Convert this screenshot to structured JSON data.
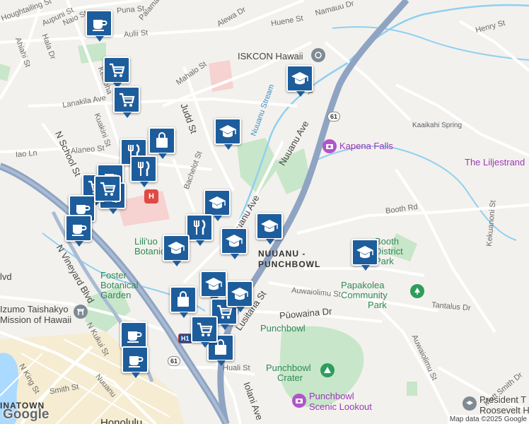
{
  "roads": [
    "Houghtailing St",
    "Aupuni St",
    "Naio St",
    "Puna St",
    "Palama St",
    "Aulii St",
    "Alewa Dr",
    "Huene St",
    "Namauu Dr",
    "Henry St",
    "Ahiahi St",
    "Hala Dr",
    "Mahalo St",
    "Kealoha",
    "Lanakila Ave",
    "Kuakini St",
    "Judd St",
    "Alaneo St",
    "Iao Ln",
    "N School St",
    "Bachelot St",
    "Nuuanu Ave",
    "Booth Rd",
    "Kekuanoni St",
    "N Vineyard Blvd",
    "Auwaiolimu St",
    "Tantalus Dr",
    "Lusitana St",
    "Pūowaina Dr",
    "N Kukui St",
    "Nuuanu",
    "N King St",
    "Smith St",
    "Huali St",
    "Iolani Ave",
    "Auwaiolimu St",
    "Mott Smith Dr",
    "St"
  ],
  "places": {
    "iskcon": "ISKCON Hawaii",
    "kapena": "Kapena Falls",
    "kaaikahi": "Kaaikahi Spring",
    "liljestrand": "The Liljestrand",
    "stream": "Nuuanu Stream",
    "liliu": "Lili'uo Botanic",
    "booth": "Booth District Park",
    "nbh1": "NUUANU -",
    "nbh2": "PUNCHBOWL",
    "foster1": "Foster",
    "foster2": "Botanical",
    "foster3": "Garden",
    "izumo1": "Izumo Taishakyo",
    "izumo2": "Mission of Hawaii",
    "papakolea1": "Papakolea",
    "papakolea2": "Community",
    "papakolea3": "Park",
    "punchbowl": "Punchbowl",
    "crater1": "Punchbowl",
    "crater2": "Crater",
    "lookout1": "Punchbowl",
    "lookout2": "Scenic Lookout",
    "president1": "President T",
    "president2": "Roosevelt H",
    "chinatown": "INATOWN",
    "honolulu": "Honolulu",
    "blvd": "lvd"
  },
  "shields": {
    "r61a": "61",
    "r61b": "61",
    "h1": "H1"
  },
  "hospital": "H",
  "markers": [
    {
      "icon": "coffee-icon"
    },
    {
      "icon": "shopping-cart-icon"
    },
    {
      "icon": "shopping-cart-icon"
    },
    {
      "icon": "shopping-bag-icon"
    },
    {
      "icon": "graduation-cap-icon"
    },
    {
      "icon": "graduation-cap-icon"
    },
    {
      "icon": "restaurant-icon"
    },
    {
      "icon": "restaurant-icon"
    },
    {
      "icon": "shopping-cart-icon"
    },
    {
      "icon": "coffee-icon"
    },
    {
      "icon": "coffee-icon"
    },
    {
      "icon": "graduation-cap-icon"
    },
    {
      "icon": "restaurant-icon"
    },
    {
      "icon": "restaurant-icon"
    },
    {
      "icon": "graduation-cap-icon"
    },
    {
      "icon": "graduation-cap-icon"
    },
    {
      "icon": "graduation-cap-icon"
    },
    {
      "icon": "coffee-icon"
    },
    {
      "icon": "graduation-cap-icon"
    },
    {
      "icon": "shopping-bag-icon"
    },
    {
      "icon": "graduation-cap-icon"
    },
    {
      "icon": "shopping-cart-icon"
    },
    {
      "icon": "shopping-cart-icon"
    },
    {
      "icon": "shopping-bag-icon"
    },
    {
      "icon": "shopping-cart-icon"
    },
    {
      "icon": "coffee-icon"
    },
    {
      "icon": "graduation-cap-icon"
    },
    {
      "icon": "coffee-icon"
    }
  ],
  "branding": "Google",
  "attribution": "Map data ©2025 Google",
  "colors": {
    "marker": "#1e5d9c",
    "water": "#aadaff",
    "park": "#c8e6c9",
    "freeway": "#8fa4c3",
    "road": "#ffffff"
  }
}
